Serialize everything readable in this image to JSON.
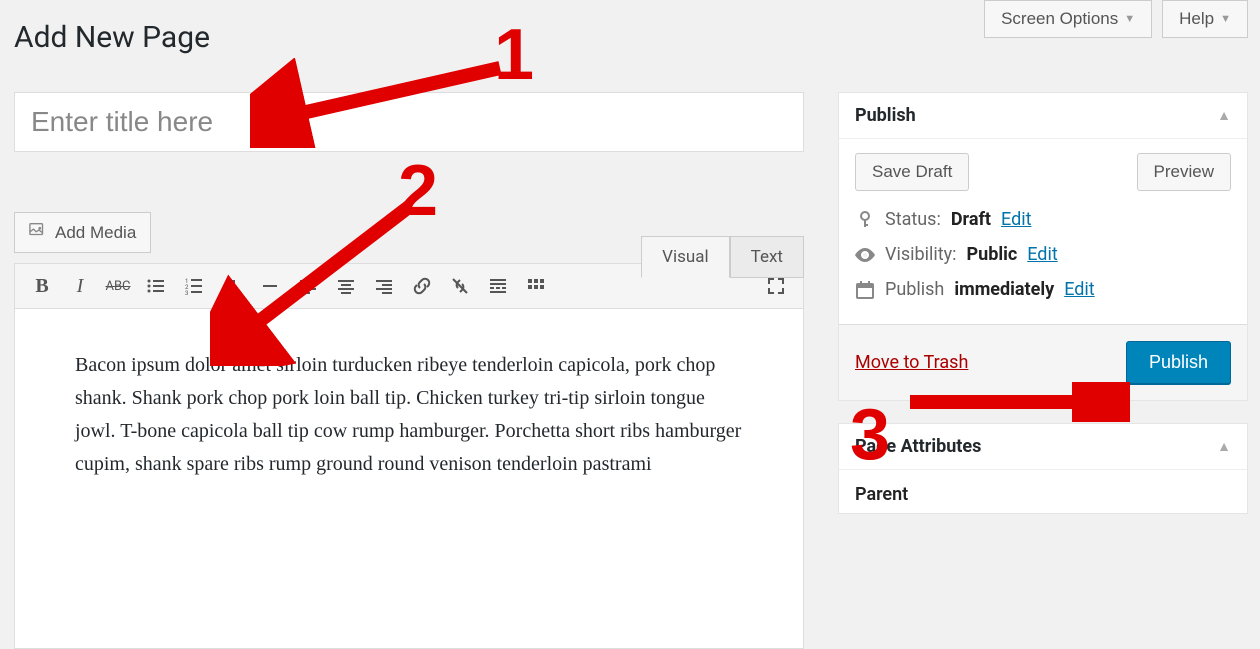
{
  "top": {
    "screen_options": "Screen Options",
    "help": "Help"
  },
  "heading": "Add New Page",
  "title_placeholder": "Enter title here",
  "add_media": "Add Media",
  "tabs": {
    "visual": "Visual",
    "text": "Text"
  },
  "toolbar": {
    "bold": "B",
    "italic": "I",
    "strike": "ABC",
    "ul": "•",
    "ol": "1",
    "quote": "❝",
    "hr": "—",
    "left": "≡",
    "center": "≡",
    "right": "≡",
    "link": "🔗",
    "unlink": "✂",
    "more": "⊞",
    "kitchen": "☰",
    "fullscreen": "⤢"
  },
  "editor_body": "Bacon ipsum dolor amet sirloin turducken ribeye tenderloin capicola, pork chop shank. Shank pork chop pork loin ball tip. Chicken turkey tri-tip sirloin tongue jowl. T-bone capicola ball tip cow rump hamburger. Porchetta short ribs hamburger cupim, shank spare ribs rump ground round venison tenderloin pastrami",
  "publish": {
    "box_title": "Publish",
    "save_draft": "Save Draft",
    "preview": "Preview",
    "status_label": "Status:",
    "status_value": "Draft",
    "visibility_label": "Visibility:",
    "visibility_value": "Public",
    "publish_label": "Publish",
    "publish_value": "immediately",
    "edit": "Edit",
    "trash": "Move to Trash",
    "publish_button": "Publish"
  },
  "page_attributes": {
    "box_title": "Page Attributes",
    "parent_label": "Parent"
  },
  "annotations": {
    "one": "1",
    "two": "2",
    "three": "3"
  }
}
